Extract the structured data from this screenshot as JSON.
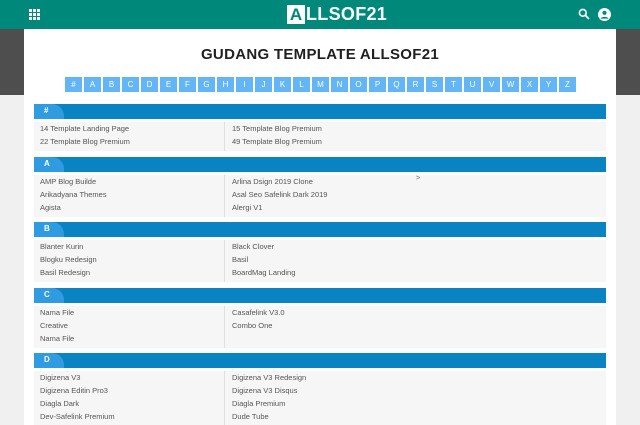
{
  "topbar": {
    "logo_initial": "A",
    "logo_rest": "LLSOF21",
    "icons": [
      "apps-grid-icon",
      "search-icon",
      "account-icon"
    ]
  },
  "page": {
    "title": "GUDANG TEMPLATE ALLSOF21"
  },
  "alphabet": [
    "#",
    "A",
    "B",
    "C",
    "D",
    "E",
    "F",
    "G",
    "H",
    "I",
    "J",
    "K",
    "L",
    "M",
    "N",
    "O",
    "P",
    "Q",
    "R",
    "S",
    "T",
    "U",
    "V",
    "W",
    "X",
    "Y",
    "Z"
  ],
  "sections": [
    {
      "label": "#",
      "left": [
        "14 Template Landing Page",
        "22 Template Blog Premium"
      ],
      "right": [
        "15 Template Blog Premium",
        "49 Template Blog Premium"
      ]
    },
    {
      "label": "A",
      "left": [
        "AMP Blog Builde",
        "Arikadyana Themes",
        "Agista"
      ],
      "right": [
        "Arlina Dsign 2019 Clone",
        "Asal Seo Safelink Dark 2019",
        "Alergi V1"
      ],
      "stray": ">"
    },
    {
      "label": "B",
      "left": [
        "Blanter Kurin",
        "Blogku Redesign",
        "Basil Redesign"
      ],
      "right": [
        "Black Clover",
        "Basil",
        "BoardMag Landing"
      ]
    },
    {
      "label": "C",
      "left": [
        "Nama File",
        "Creative",
        "Nama File"
      ],
      "right": [
        "Casafelink V3.0",
        "Combo One"
      ]
    },
    {
      "label": "D",
      "left": [
        "Digizena V3",
        "Digizena Editin Pro3",
        "Diagla Dark",
        "Dev-Safelink Premium"
      ],
      "right": [
        "Digizena V3 Redesign",
        "Digizena V3 Disqus",
        "Diagla Premium",
        "Dude Tube"
      ]
    }
  ],
  "colors": {
    "topbar": "#00897b",
    "section_header": "#0a83c2",
    "alpha_button": "#64b5f6"
  }
}
